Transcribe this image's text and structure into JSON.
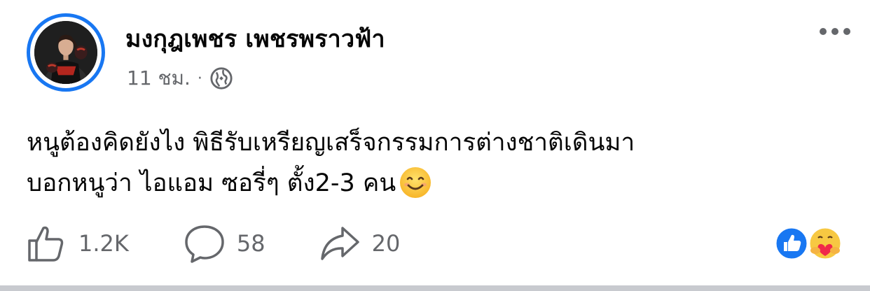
{
  "post": {
    "author": "มงกุฎเพชร เพชรพราวฟ้า",
    "time": "11 ชม.",
    "separator": "·",
    "privacy_icon": "globe-icon",
    "text_line1": "หนูต้องคิดยังไง พิธีรับเหรียญเสร็จกรรมการต่างชาติเดินมา",
    "text_line2": "บอกหนูว่า ไอแอม ซอรี่ๆ ตั้ง2-3 คน",
    "emoji": "smiling-face-emoji"
  },
  "stats": {
    "likes": "1.2K",
    "comments": "58",
    "shares": "20"
  },
  "reactions": [
    "like-reaction-icon",
    "care-reaction-icon"
  ],
  "colors": {
    "accent": "#1877f2",
    "secondary_text": "#65676b",
    "primary_text": "#050505"
  }
}
